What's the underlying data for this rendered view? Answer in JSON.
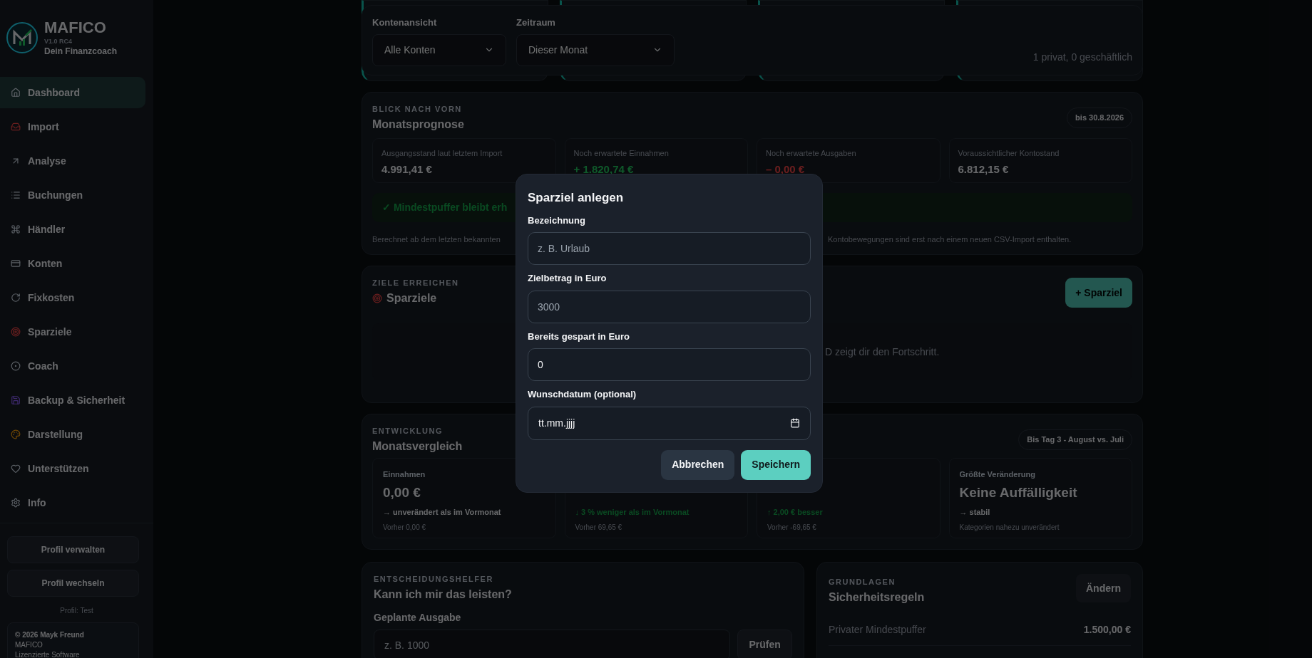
{
  "sidebar": {
    "brand": "MAFICO",
    "version": "V1.0 RC4",
    "tagline": "Dein Finanzcoach",
    "nav": [
      {
        "label": "Dashboard",
        "selected": true
      },
      {
        "label": "Import",
        "selected": false
      },
      {
        "label": "Analyse",
        "selected": false
      },
      {
        "label": "Buchungen",
        "selected": false
      },
      {
        "label": "Händler",
        "selected": false
      },
      {
        "label": "Konten",
        "selected": false
      },
      {
        "label": "Fixkosten",
        "selected": false
      },
      {
        "label": "Sparziele",
        "selected": false
      },
      {
        "label": "Coach",
        "selected": false
      },
      {
        "label": "Backup & Sicherheit",
        "selected": false
      },
      {
        "label": "Darstellung",
        "selected": false
      },
      {
        "label": "Unterstützen",
        "selected": false
      },
      {
        "label": "Info",
        "selected": false
      }
    ],
    "buttons": [
      "Profil verwalten",
      "Profil wechseln"
    ],
    "profile": "Profil: Test",
    "footer": [
      "© 2026 Mayk Freund",
      "MAFICO",
      "Lizenzierte Software"
    ]
  },
  "filters": {
    "fields": [
      {
        "label": "Kontenansicht",
        "value": "Alle Konten"
      },
      {
        "label": "Zeitraum",
        "value": "Dieser Monat"
      }
    ],
    "summary": "1 privat, 0 geschäftlich"
  },
  "forecast": {
    "eyebrow": "BLICK NACH VORN",
    "title": "Monatsprognose",
    "badge": "bis 30.8.2026",
    "tiles": [
      {
        "label": "Ausgangsstand laut letztem Import",
        "value": "4.991,41 €",
        "kind": "neutral"
      },
      {
        "label": "Noch erwartete Einnahmen",
        "value": "+ 1.820,74 €",
        "kind": "positive"
      },
      {
        "label": "Noch erwartete Ausgaben",
        "value": "– 0,00 €",
        "kind": "negative"
      },
      {
        "label": "Voraussichtlicher Kontostand",
        "value": "6.812,15 €",
        "kind": "neutral"
      }
    ],
    "banner": "✓ Mindestpuffer bleibt erh",
    "note_left": "Berechnet ab dem letzten bekannten",
    "note_right": "Kontobewegungen sind erst nach einem neuen CSV-Import enthalten."
  },
  "goals": {
    "eyebrow": "ZIELE ERREICHEN",
    "title": "Sparziele",
    "button": "+ Sparziel",
    "empty_text": "D zeigt dir den Fortschritt."
  },
  "comparison": {
    "eyebrow": "ENTWICKLUNG",
    "title": "Monatsvergleich",
    "badge": "Bis Tag 3 - August vs. Juli",
    "tiles": [
      {
        "label": "Einnahmen",
        "value": "0,00 €",
        "trend": "→ unverändert als im Vormonat",
        "kind": "neutral",
        "previous": "Vorher 0,00 €"
      },
      {
        "trend": "↓ 3 % weniger als im Vormonat",
        "kind": "positive",
        "previous": "Vorher 69,65 €"
      },
      {
        "trend": "↑ 2,00 € besser",
        "kind": "positive",
        "previous": "Vorher -69,65 €"
      },
      {
        "label": "Größte Veränderung",
        "value": "Keine Auffälligkeit",
        "trend": "→ stabil",
        "kind": "neutral",
        "previous": "Kategorien nahezu unverändert"
      }
    ]
  },
  "affordability": {
    "eyebrow": "ENTSCHEIDUNGSHELFER",
    "title": "Kann ich mir das leisten?",
    "field_label": "Geplante Ausgabe",
    "placeholder": "z. B. 1000",
    "button": "Prüfen"
  },
  "rules": {
    "eyebrow": "GRUNDLAGEN",
    "title": "Sicherheitsregeln",
    "button": "Ändern",
    "rows": [
      {
        "label": "Privater Mindestpuffer",
        "value": "1.500,00 €"
      }
    ]
  },
  "dialog": {
    "title": "Sparziel anlegen",
    "fields": [
      {
        "label": "Bezeichnung",
        "placeholder": "z. B. Urlaub",
        "kind": "text"
      },
      {
        "label": "Zielbetrag in Euro",
        "placeholder": "3000",
        "kind": "text"
      },
      {
        "label": "Bereits gespart in Euro",
        "value": "0",
        "kind": "text"
      },
      {
        "label": "Wunschdatum (optional)",
        "value": "tt.mm.jjjj",
        "kind": "date"
      }
    ],
    "buttons": [
      {
        "label": "Abbrechen",
        "kind": "secondary"
      },
      {
        "label": "Speichern",
        "kind": "primary"
      }
    ]
  }
}
